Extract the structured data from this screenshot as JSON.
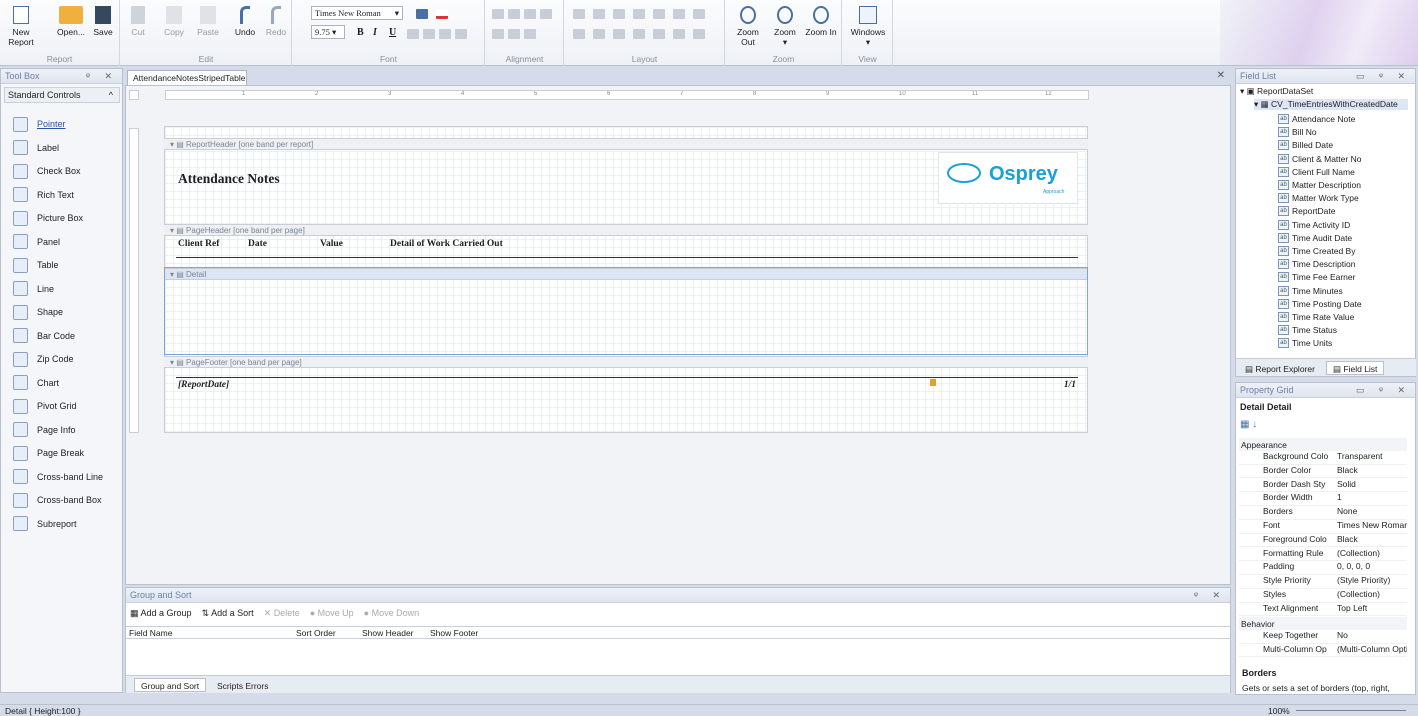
{
  "ribbon": {
    "groups": [
      {
        "label": "Report"
      },
      {
        "label": "Edit"
      },
      {
        "label": "Font"
      },
      {
        "label": "Alignment"
      },
      {
        "label": "Layout"
      },
      {
        "label": "Zoom"
      },
      {
        "label": "View"
      }
    ],
    "report": {
      "new": "New Report",
      "open": "Open...",
      "save": "Save"
    },
    "edit": {
      "cut": "Cut",
      "copy": "Copy",
      "paste": "Paste",
      "undo": "Undo",
      "redo": "Redo"
    },
    "font": {
      "family": "Times New Roman",
      "size": "9.75",
      "bold": "B",
      "italic": "I",
      "underline": "U"
    },
    "zoom": {
      "out": "Zoom Out",
      "zoom": "Zoom",
      "in": "Zoom In"
    },
    "view": {
      "windows": "Windows"
    }
  },
  "toolbox": {
    "title": "Tool Box",
    "category": "Standard Controls",
    "items": [
      "Pointer",
      "Label",
      "Check Box",
      "Rich Text",
      "Picture Box",
      "Panel",
      "Table",
      "Line",
      "Shape",
      "Bar Code",
      "Zip Code",
      "Chart",
      "Pivot Grid",
      "Page Info",
      "Page Break",
      "Cross-band Line",
      "Cross-band Box",
      "Subreport"
    ]
  },
  "doc_tab": "AttendanceNotesStripedTable",
  "bands": {
    "report_header": "ReportHeader [one band per report]",
    "page_header": "PageHeader [one band per page]",
    "detail": "Detail",
    "page_footer": "PageFooter [one band per page]"
  },
  "report": {
    "title": "Attendance Notes",
    "logo_text": "Osprey",
    "logo_sub": "Approach",
    "columns": [
      "Client Ref",
      "Date",
      "Value",
      "Detail of Work Carried Out"
    ],
    "footer_date": "[ReportDate]",
    "footer_page": "1/1"
  },
  "ruler_numbers": [
    "1",
    "2",
    "3",
    "4",
    "5",
    "6",
    "7",
    "8",
    "9",
    "10",
    "11",
    "12"
  ],
  "field_list": {
    "title": "Field List",
    "root": "ReportDataSet",
    "table": "CV_TimeEntriesWithCreatedDate",
    "fields": [
      "Attendance Note",
      "Bill No",
      "Billed Date",
      "Client & Matter No",
      "Client Full Name",
      "Matter Description",
      "Matter Work Type",
      "ReportDate",
      "Time Activity ID",
      "Time Audit Date",
      "Time Created By",
      "Time Description",
      "Time Fee Earner",
      "Time Minutes",
      "Time Posting Date",
      "Time Rate Value",
      "Time Status",
      "Time Units"
    ],
    "tab_explorer": "Report Explorer",
    "tab_fields": "Field List"
  },
  "property_grid": {
    "title": "Property Grid",
    "selected": "Detail  Detail",
    "cat_appearance": "Appearance",
    "cat_behavior": "Behavior",
    "rows": [
      {
        "k": "Background Colo",
        "v": "Transparent"
      },
      {
        "k": "Border Color",
        "v": "Black"
      },
      {
        "k": "Border Dash Sty",
        "v": "Solid"
      },
      {
        "k": "Border Width",
        "v": "1"
      },
      {
        "k": "Borders",
        "v": "None"
      },
      {
        "k": "Font",
        "v": "Times New Roman,..."
      },
      {
        "k": "Foreground Colo",
        "v": "Black"
      },
      {
        "k": "Formatting Rule",
        "v": "(Collection)"
      },
      {
        "k": "Padding",
        "v": "0, 0, 0, 0"
      },
      {
        "k": "Style Priority",
        "v": "(Style Priority)"
      },
      {
        "k": "Styles",
        "v": "(Collection)"
      },
      {
        "k": "Text Alignment",
        "v": "Top Left"
      }
    ],
    "behavior_rows": [
      {
        "k": "Keep Together",
        "v": "No"
      },
      {
        "k": "Multi-Column Op",
        "v": "(Multi-Column Opti..."
      }
    ],
    "desc_title": "Borders",
    "desc": "Gets or sets a set of borders (top, right,"
  },
  "group_sort": {
    "title": "Group and Sort",
    "add_group": "Add a Group",
    "add_sort": "Add a Sort",
    "delete": "Delete",
    "move_up": "Move Up",
    "move_down": "Move Down",
    "columns": [
      "Field Name",
      "Sort Order",
      "Show Header",
      "Show Footer"
    ],
    "tab1": "Group and Sort",
    "tab2": "Scripts Errors"
  },
  "status": {
    "left": "Detail { Height:100 }",
    "zoom": "100%"
  },
  "colors": {
    "accent": "#6c7fa8",
    "logo": "#1aa0d8",
    "selection": "#7ea3d8"
  }
}
